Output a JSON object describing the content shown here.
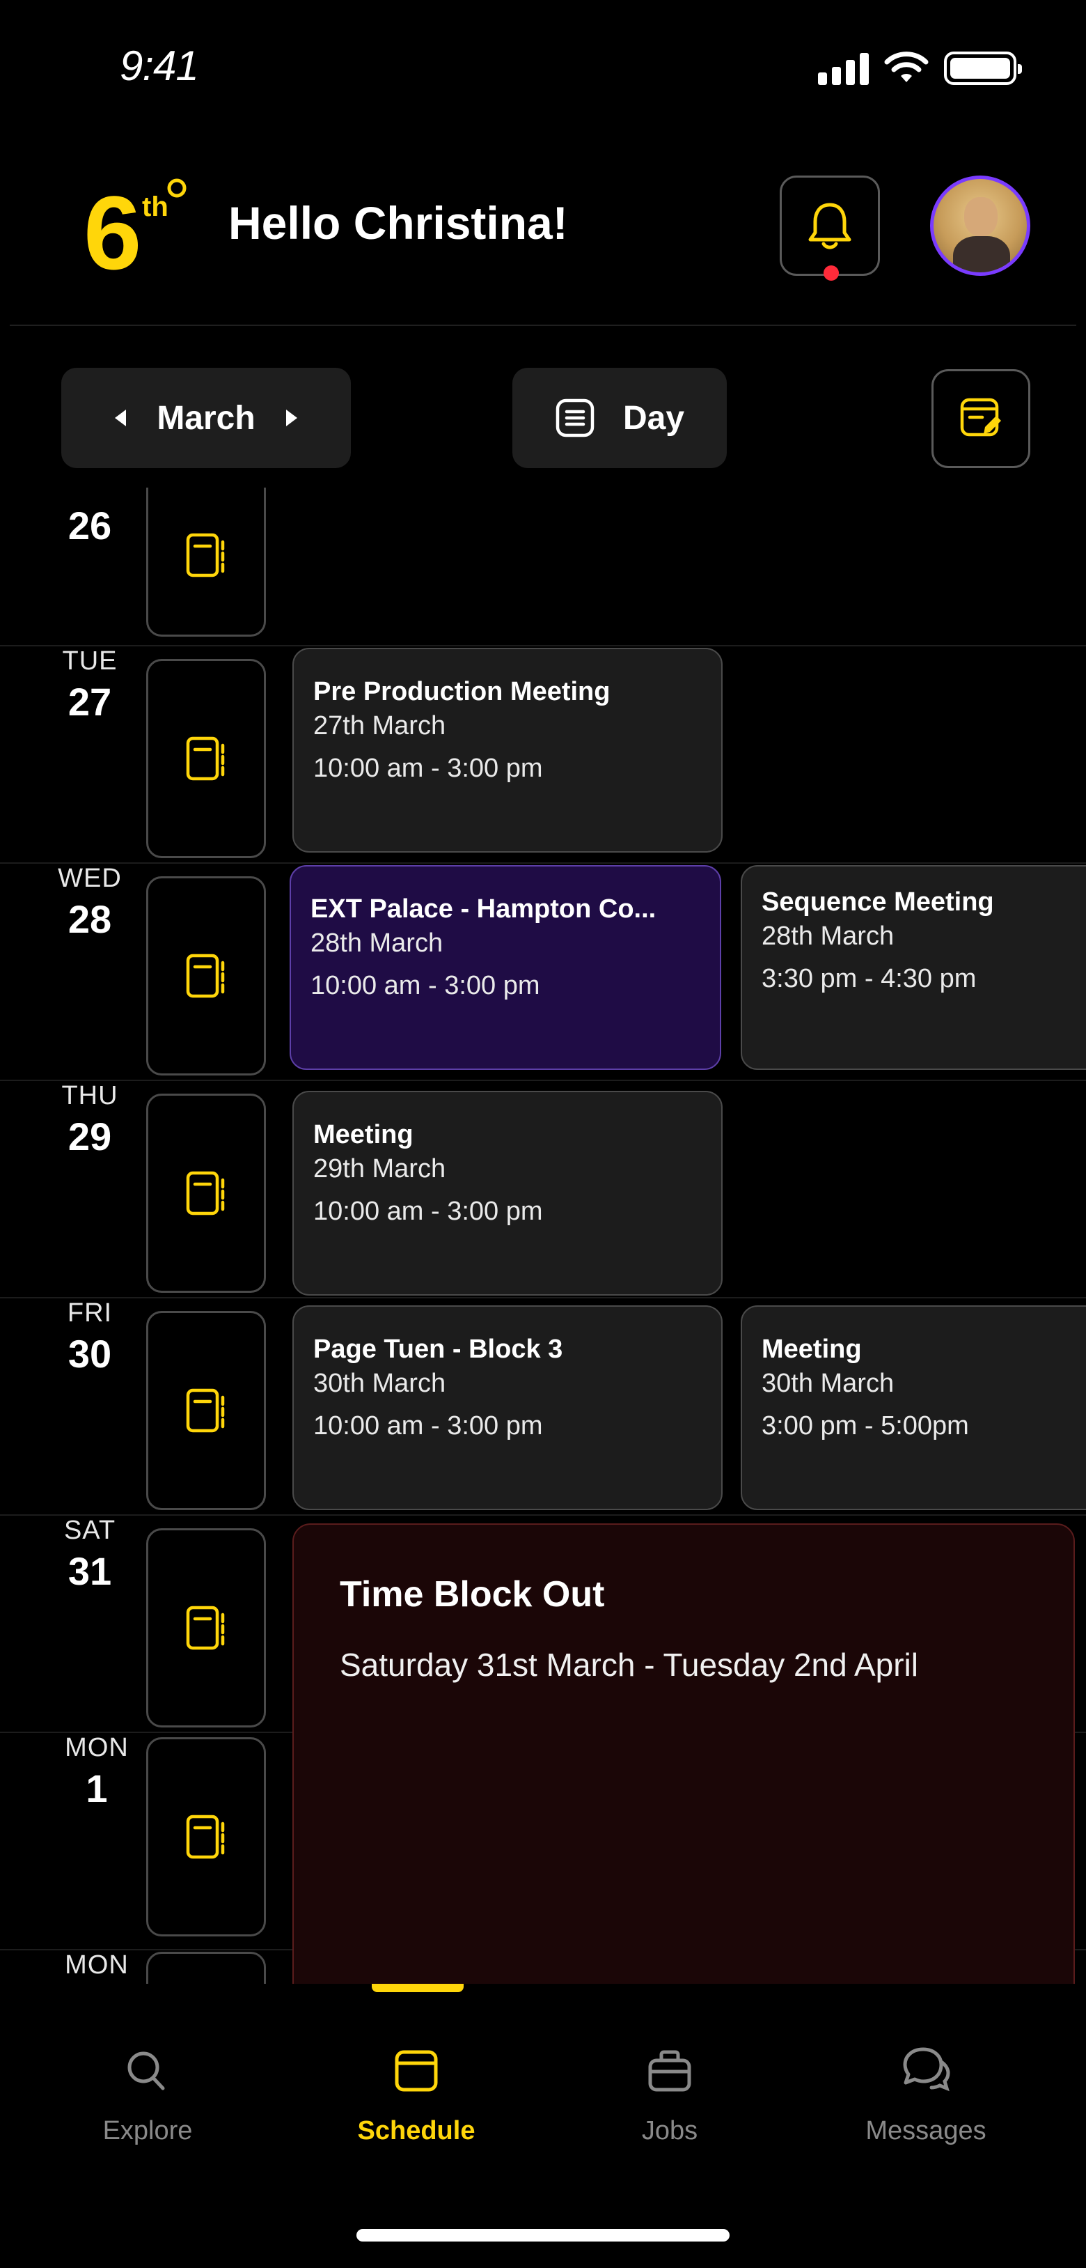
{
  "status_bar": {
    "time": "9:41"
  },
  "header": {
    "logo_number": "6",
    "logo_suffix": "th",
    "greeting": "Hello Christina!",
    "has_notification": true
  },
  "controls": {
    "month": "March",
    "view": "Day"
  },
  "colors": {
    "accent": "#FFD60A",
    "notification_dot": "#FF2B3A",
    "purple_event": "#1F0C45",
    "blockout": "#1B0607"
  },
  "days": [
    {
      "dow": "",
      "num": "26"
    },
    {
      "dow": "TUE",
      "num": "27"
    },
    {
      "dow": "WED",
      "num": "28"
    },
    {
      "dow": "THU",
      "num": "29"
    },
    {
      "dow": "FRI",
      "num": "30"
    },
    {
      "dow": "SAT",
      "num": "31"
    },
    {
      "dow": "MON",
      "num": "1"
    },
    {
      "dow": "MON",
      "num": ""
    }
  ],
  "events": [
    {
      "title": "Pre Production Meeting",
      "date": "27th March",
      "time": "10:00 am - 3:00 pm"
    },
    {
      "title": "EXT Palace - Hampton Co...",
      "date": "28th March",
      "time": "10:00 am - 3:00 pm"
    },
    {
      "title": "Sequence Meeting",
      "date": "28th March",
      "time": "3:30 pm - 4:30 pm"
    },
    {
      "title": "Meeting",
      "date": "29th March",
      "time": "10:00 am - 3:00 pm"
    },
    {
      "title": "Page Tuen - Block 3",
      "date": "30th March",
      "time": "10:00 am - 3:00 pm"
    },
    {
      "title": "Meeting",
      "date": "30th March",
      "time": "3:00 pm - 5:00pm"
    }
  ],
  "blockout": {
    "title": "Time Block Out",
    "range": "Saturday 31st March - Tuesday 2nd April"
  },
  "nav": [
    {
      "label": "Explore",
      "icon": "search-icon"
    },
    {
      "label": "Schedule",
      "icon": "calendar-icon",
      "active": true
    },
    {
      "label": "Jobs",
      "icon": "briefcase-icon"
    },
    {
      "label": "Messages",
      "icon": "chat-icon"
    }
  ]
}
